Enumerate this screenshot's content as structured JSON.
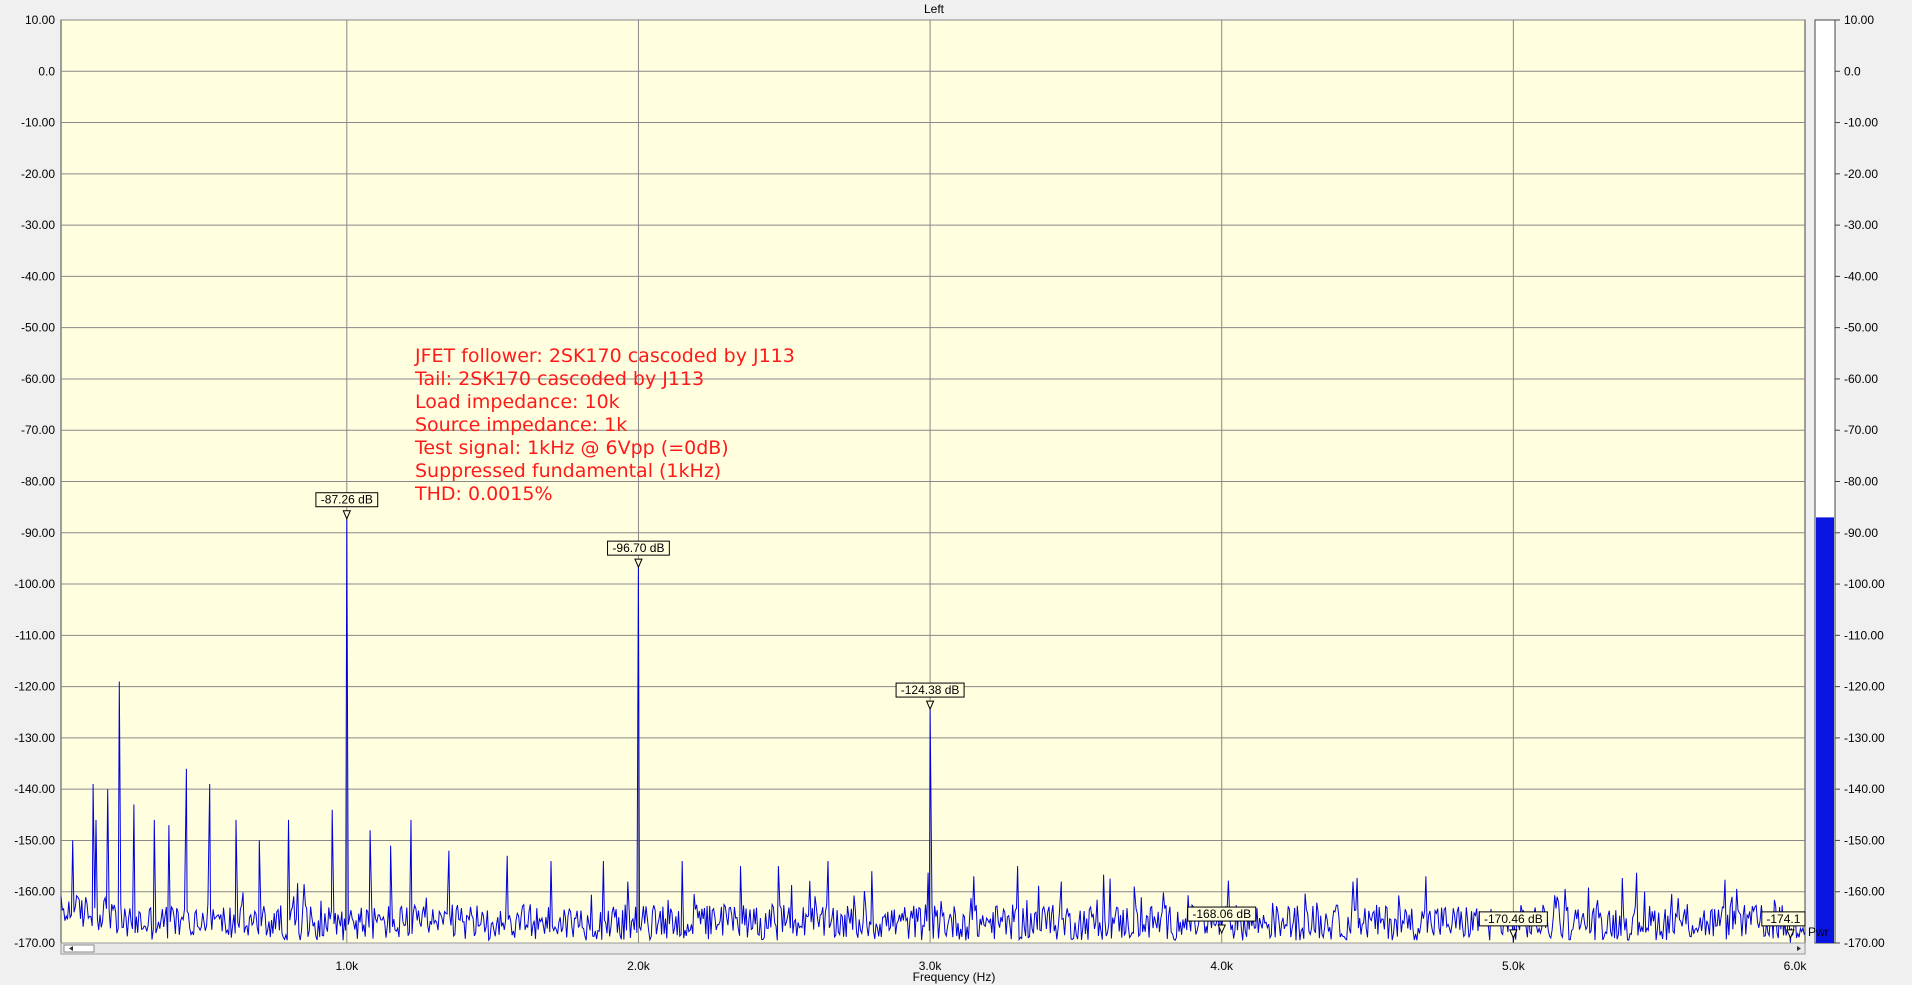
{
  "chart_data": {
    "type": "line",
    "title": "Left",
    "xlabel": "Frequency (Hz)",
    "ylabel": "",
    "xlim": [
      20,
      6000
    ],
    "ylim": [
      -170,
      10
    ],
    "x_ticks": [
      {
        "value": 1000,
        "label": "1.0k"
      },
      {
        "value": 2000,
        "label": "2.0k"
      },
      {
        "value": 3000,
        "label": "3.0k"
      },
      {
        "value": 4000,
        "label": "4.0k"
      },
      {
        "value": 5000,
        "label": "5.0k"
      },
      {
        "value": 6000,
        "label": "6.0k"
      }
    ],
    "y_ticks": [
      {
        "value": 10,
        "label": "10.00"
      },
      {
        "value": 0,
        "label": "0.0"
      },
      {
        "value": -10,
        "label": "-10.00"
      },
      {
        "value": -20,
        "label": "-20.00"
      },
      {
        "value": -30,
        "label": "-30.00"
      },
      {
        "value": -40,
        "label": "-40.00"
      },
      {
        "value": -50,
        "label": "-50.00"
      },
      {
        "value": -60,
        "label": "-60.00"
      },
      {
        "value": -70,
        "label": "-70.00"
      },
      {
        "value": -80,
        "label": "-80.00"
      },
      {
        "value": -90,
        "label": "-90.00"
      },
      {
        "value": -100,
        "label": "-100.00"
      },
      {
        "value": -110,
        "label": "-110.00"
      },
      {
        "value": -120,
        "label": "-120.00"
      },
      {
        "value": -130,
        "label": "-130.00"
      },
      {
        "value": -140,
        "label": "-140.00"
      },
      {
        "value": -150,
        "label": "-150.00"
      },
      {
        "value": -160,
        "label": "-160.00"
      },
      {
        "value": -170,
        "label": "-170.00"
      }
    ],
    "grid": true,
    "noise_floor_db": -166,
    "peaks": [
      {
        "x": 60,
        "y": -150
      },
      {
        "x": 130,
        "y": -139
      },
      {
        "x": 140,
        "y": -146
      },
      {
        "x": 180,
        "y": -140
      },
      {
        "x": 220,
        "y": -119
      },
      {
        "x": 270,
        "y": -143
      },
      {
        "x": 340,
        "y": -146
      },
      {
        "x": 390,
        "y": -147
      },
      {
        "x": 450,
        "y": -136
      },
      {
        "x": 530,
        "y": -139
      },
      {
        "x": 620,
        "y": -146
      },
      {
        "x": 700,
        "y": -150
      },
      {
        "x": 800,
        "y": -146
      },
      {
        "x": 950,
        "y": -144
      },
      {
        "x": 1000,
        "y": -87.26
      },
      {
        "x": 1080,
        "y": -148
      },
      {
        "x": 1150,
        "y": -151
      },
      {
        "x": 1220,
        "y": -146
      },
      {
        "x": 1350,
        "y": -152
      },
      {
        "x": 1550,
        "y": -153
      },
      {
        "x": 1700,
        "y": -154
      },
      {
        "x": 1880,
        "y": -154
      },
      {
        "x": 2000,
        "y": -96.7
      },
      {
        "x": 2150,
        "y": -154
      },
      {
        "x": 2350,
        "y": -155
      },
      {
        "x": 2480,
        "y": -155
      },
      {
        "x": 2650,
        "y": -154
      },
      {
        "x": 2800,
        "y": -156
      },
      {
        "x": 3000,
        "y": -124.38
      },
      {
        "x": 3150,
        "y": -157
      },
      {
        "x": 3300,
        "y": -155
      },
      {
        "x": 3450,
        "y": -158
      },
      {
        "x": 3700,
        "y": -159
      },
      {
        "x": 3950,
        "y": -168.06
      },
      {
        "x": 4450,
        "y": -158
      },
      {
        "x": 4700,
        "y": -157
      },
      {
        "x": 5000,
        "y": -170.46
      },
      {
        "x": 5150,
        "y": -161
      },
      {
        "x": 5450,
        "y": -160
      },
      {
        "x": 5750,
        "y": -161
      },
      {
        "x": 5950,
        "y": -174.1
      }
    ],
    "markers": [
      {
        "x": 1000,
        "y": -87.26,
        "label": "-87.26 dB"
      },
      {
        "x": 2000,
        "y": -96.7,
        "label": "-96.70 dB"
      },
      {
        "x": 3000,
        "y": -124.38,
        "label": "-124.38 dB"
      },
      {
        "x": 4000,
        "y": -168.06,
        "label": "-168.06 dB"
      },
      {
        "x": 5000,
        "y": -170.46,
        "label": "-170.46 dB"
      },
      {
        "x": 5950,
        "y": -174.1,
        "label": "-174.1"
      }
    ],
    "annotation_lines": [
      "JFET follower: 2SK170 cascoded by J113",
      "Tail: 2SK170 cascoded by J113",
      "Load impedance: 10k",
      "Source impedance: 1k",
      "Test signal: 1kHz @ 6Vpp (=0dB)",
      "Suppressed fundamental (1kHz)",
      "THD: 0.0015%"
    ],
    "colors": {
      "plot_background": "#ffffe0",
      "trace": "#0000dd",
      "grid": "#888888",
      "annotation": "#ff1a1a",
      "meter_fill": "#0a14e0"
    }
  },
  "meter": {
    "label": "Pwr",
    "ylim": [
      -170,
      10
    ],
    "level_db": -87
  }
}
